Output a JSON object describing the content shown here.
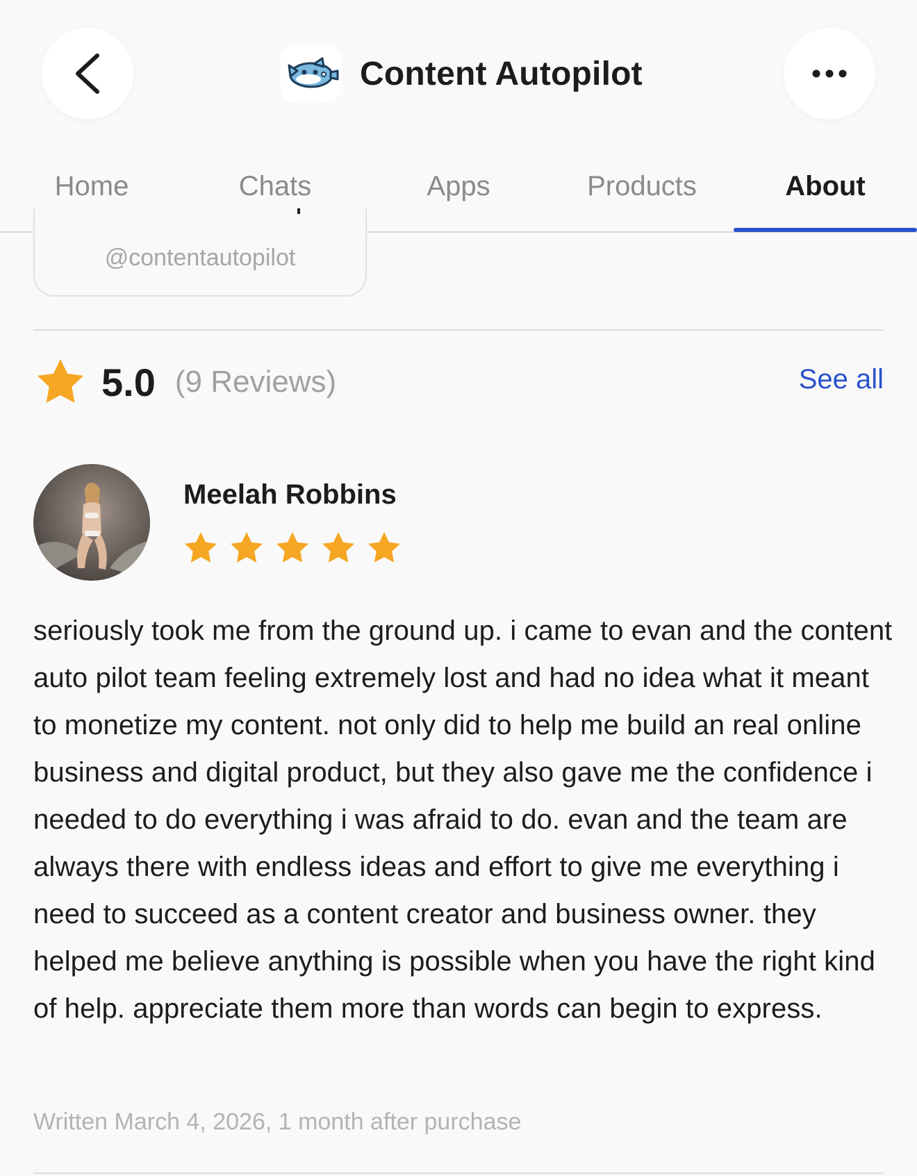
{
  "header": {
    "title": "Content Autopilot",
    "back_icon": "chevron-left-icon",
    "more_icon": "ellipsis-icon",
    "logo_icon": "airplane-fish-logo"
  },
  "tabs": [
    {
      "label": "Home",
      "active": false
    },
    {
      "label": "Chats",
      "active": false
    },
    {
      "label": "Apps",
      "active": false
    },
    {
      "label": "Products",
      "active": false
    },
    {
      "label": "About",
      "active": true
    }
  ],
  "profile": {
    "handle": "@contentautopilot"
  },
  "rating": {
    "value": "5.0",
    "count_text": "(9 Reviews)",
    "see_all_label": "See all",
    "star_icon": "star-icon"
  },
  "review": {
    "reviewer_name": "Meelah Robbins",
    "stars": 5,
    "text": "seriously took me from the ground up. i came to evan and the content auto pilot team feeling extremely lost and had no idea what it meant to monetize my content. not only did to help me build an real online business and digital product, but they also gave me the confidence i needed to do everything i was afraid to do. evan and the team are always there with endless ideas and effort to give me everything i need to succeed as a content creator and business owner. they helped me believe anything is possible when you have the right kind of help. appreciate them more than words can begin to express.",
    "written": "Written March 4, 2026, 1 month after purchase"
  },
  "colors": {
    "accent": "#2952cc",
    "star": "#f5a623",
    "muted": "#a0a0a5",
    "background": "#f9f9f9"
  }
}
